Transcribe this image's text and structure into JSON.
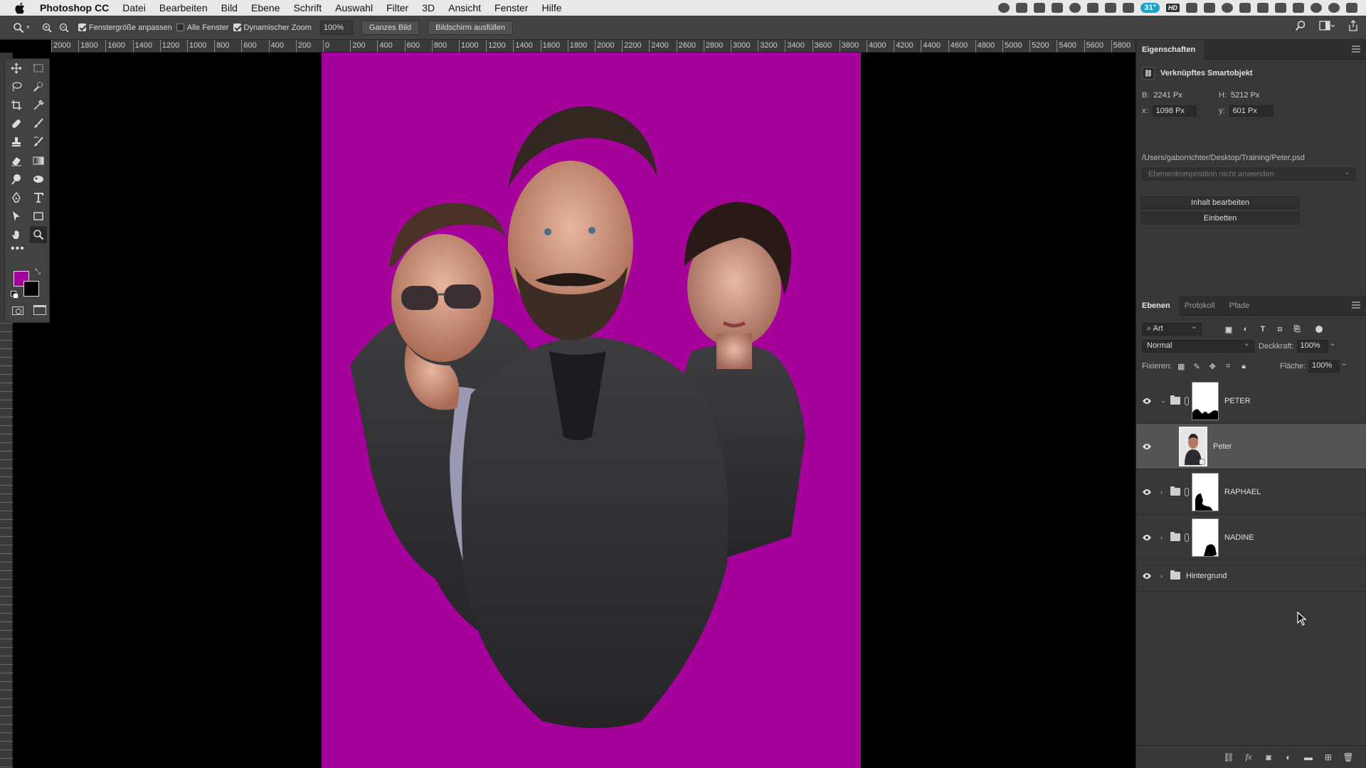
{
  "menubar": {
    "app_name": "Photoshop CC",
    "items": [
      "Datei",
      "Bearbeiten",
      "Bild",
      "Ebene",
      "Schrift",
      "Auswahl",
      "Filter",
      "3D",
      "Ansicht",
      "Fenster",
      "Hilfe"
    ],
    "status_temp": "31°",
    "status_hd": "HD"
  },
  "options": {
    "fit_window_label": "Fenstergröße anpassen",
    "fit_window_checked": true,
    "all_windows_label": "Alle Fenster",
    "all_windows_checked": false,
    "scrubby_zoom_label": "Dynamischer Zoom",
    "scrubby_zoom_checked": true,
    "zoom_value": "100%",
    "fit_screen_button": "Ganzes Bild",
    "fill_screen_button": "Bildschirm ausfüllen"
  },
  "ruler": {
    "top_ticks": [
      "2000",
      "1800",
      "1600",
      "1400",
      "1200",
      "1000",
      "800",
      "600",
      "400",
      "200",
      "0",
      "200",
      "400",
      "600",
      "800",
      "1000",
      "1200",
      "1400",
      "1600",
      "1800",
      "2000",
      "2200",
      "2400",
      "2600",
      "2800",
      "3000",
      "3200",
      "3400",
      "3600",
      "3800",
      "4000",
      "4200",
      "4400",
      "4600",
      "4800",
      "5000",
      "5200",
      "5400",
      "5600",
      "5800"
    ]
  },
  "colors": {
    "foreground": "#a6009a",
    "background": "#000000",
    "canvas_bg": "#a6009a"
  },
  "properties": {
    "tab": "Eigenschaften",
    "title": "Verknüpftes Smartobjekt",
    "width_label": "B:",
    "width_value": "2241 Px",
    "height_label": "H:",
    "height_value": "5212 Px",
    "x_label": "x:",
    "x_value": "1098 Px",
    "y_label": "y:",
    "y_value": "601 Px",
    "path": "/Users/gaborrichter/Desktop/Training/Peter.psd",
    "comp_placeholder": "Ebenenkomposition nicht anwenden",
    "edit_button": "Inhalt bearbeiten",
    "embed_button": "Einbetten"
  },
  "layers_panel": {
    "tabs": [
      "Ebenen",
      "Protokoll",
      "Pfade"
    ],
    "kind_filter": "Art",
    "blend_mode": "Normal",
    "opacity_label": "Deckkraft:",
    "opacity_value": "100%",
    "lock_label": "Fixieren:",
    "fill_label": "Fläche:",
    "fill_value": "100%",
    "layers": [
      {
        "name": "PETER",
        "type": "group",
        "expanded": true
      },
      {
        "name": "Peter",
        "type": "smart-object",
        "selected": true
      },
      {
        "name": "RAPHAEL",
        "type": "group",
        "expanded": false
      },
      {
        "name": "NADINE",
        "type": "group",
        "expanded": false
      },
      {
        "name": "Hintergrund",
        "type": "group",
        "expanded": false
      }
    ]
  }
}
